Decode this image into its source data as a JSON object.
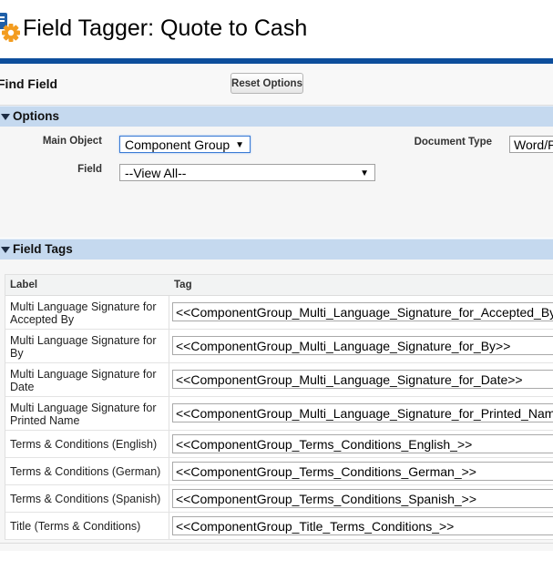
{
  "header": {
    "title": "Field Tagger: Quote to Cash"
  },
  "find": {
    "label": "Find Field",
    "reset_label": "Reset Options"
  },
  "options": {
    "title": "Options",
    "main_object_label": "Main Object",
    "main_object_value": "Component Group",
    "field_label": "Field",
    "field_value": "--View All--",
    "document_type_label": "Document Type",
    "document_type_value": "Word/P"
  },
  "field_tags": {
    "title": "Field Tags",
    "columns": {
      "label": "Label",
      "tag": "Tag"
    },
    "rows": [
      {
        "label": "Multi Language Signature for Accepted By",
        "tag": "<<ComponentGroup_Multi_Language_Signature_for_Accepted_By>>"
      },
      {
        "label": "Multi Language Signature for By",
        "tag": "<<ComponentGroup_Multi_Language_Signature_for_By>>"
      },
      {
        "label": "Multi Language Signature for Date",
        "tag": "<<ComponentGroup_Multi_Language_Signature_for_Date>>"
      },
      {
        "label": "Multi Language Signature for Printed Name",
        "tag": "<<ComponentGroup_Multi_Language_Signature_for_Printed_Name>>"
      },
      {
        "label": "Terms & Conditions (English)",
        "tag": "<<ComponentGroup_Terms_Conditions_English_>>"
      },
      {
        "label": "Terms & Conditions (German)",
        "tag": "<<ComponentGroup_Terms_Conditions_German_>>"
      },
      {
        "label": "Terms & Conditions (Spanish)",
        "tag": "<<ComponentGroup_Terms_Conditions_Spanish_>>"
      },
      {
        "label": "Title (Terms & Conditions)",
        "tag": "<<ComponentGroup_Title_Terms_Conditions_>>"
      }
    ]
  },
  "colors": {
    "brand_bar": "#0d4e9c",
    "section_header": "#c5d9ef",
    "gear": "#f39c1f"
  }
}
